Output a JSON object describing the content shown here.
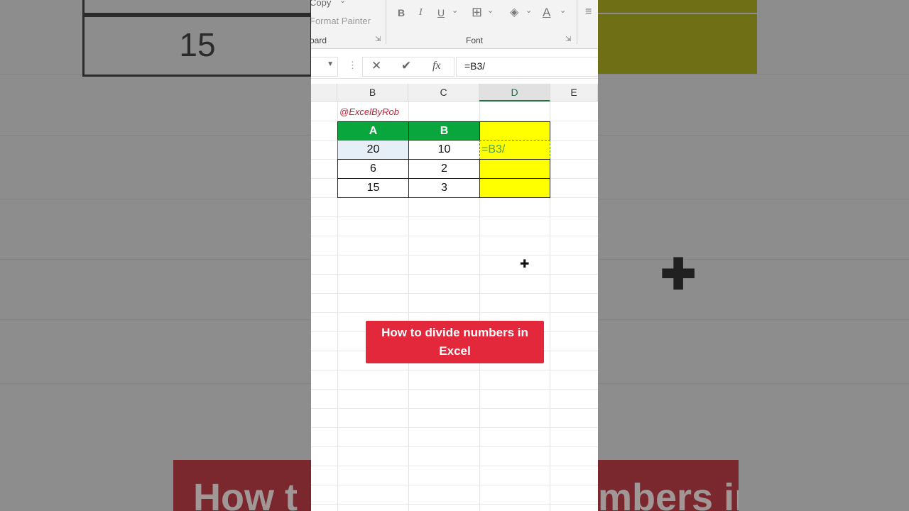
{
  "background": {
    "left_cell_value": "15",
    "banner_fragment_left": "How t",
    "banner_fragment_right": "mbers in"
  },
  "ribbon": {
    "copy_label": "Copy",
    "format_painter_label": "Format Painter",
    "clipboard_label": "oard",
    "font_label": "Font",
    "bold": "B",
    "italic": "I",
    "underline": "U",
    "font_color": "A"
  },
  "formula_bar": {
    "cancel_icon": "✕",
    "enter_icon": "✔",
    "fx_label": "fx",
    "formula": "=B3/"
  },
  "columns": [
    "B",
    "C",
    "D",
    "E"
  ],
  "watermark": "@ExcelByRob",
  "table": {
    "headers": [
      "A",
      "B",
      ""
    ],
    "rows": [
      [
        "20",
        "10",
        "=B3/"
      ],
      [
        "6",
        "2",
        ""
      ],
      [
        "15",
        "3",
        ""
      ]
    ]
  },
  "banner": {
    "line1": "How to divide numbers in",
    "line2": "Excel"
  },
  "colors": {
    "header_green": "#09a63e",
    "highlight_yellow": "#ffff00",
    "banner_red": "#e3283b",
    "excel_green": "#217346"
  }
}
